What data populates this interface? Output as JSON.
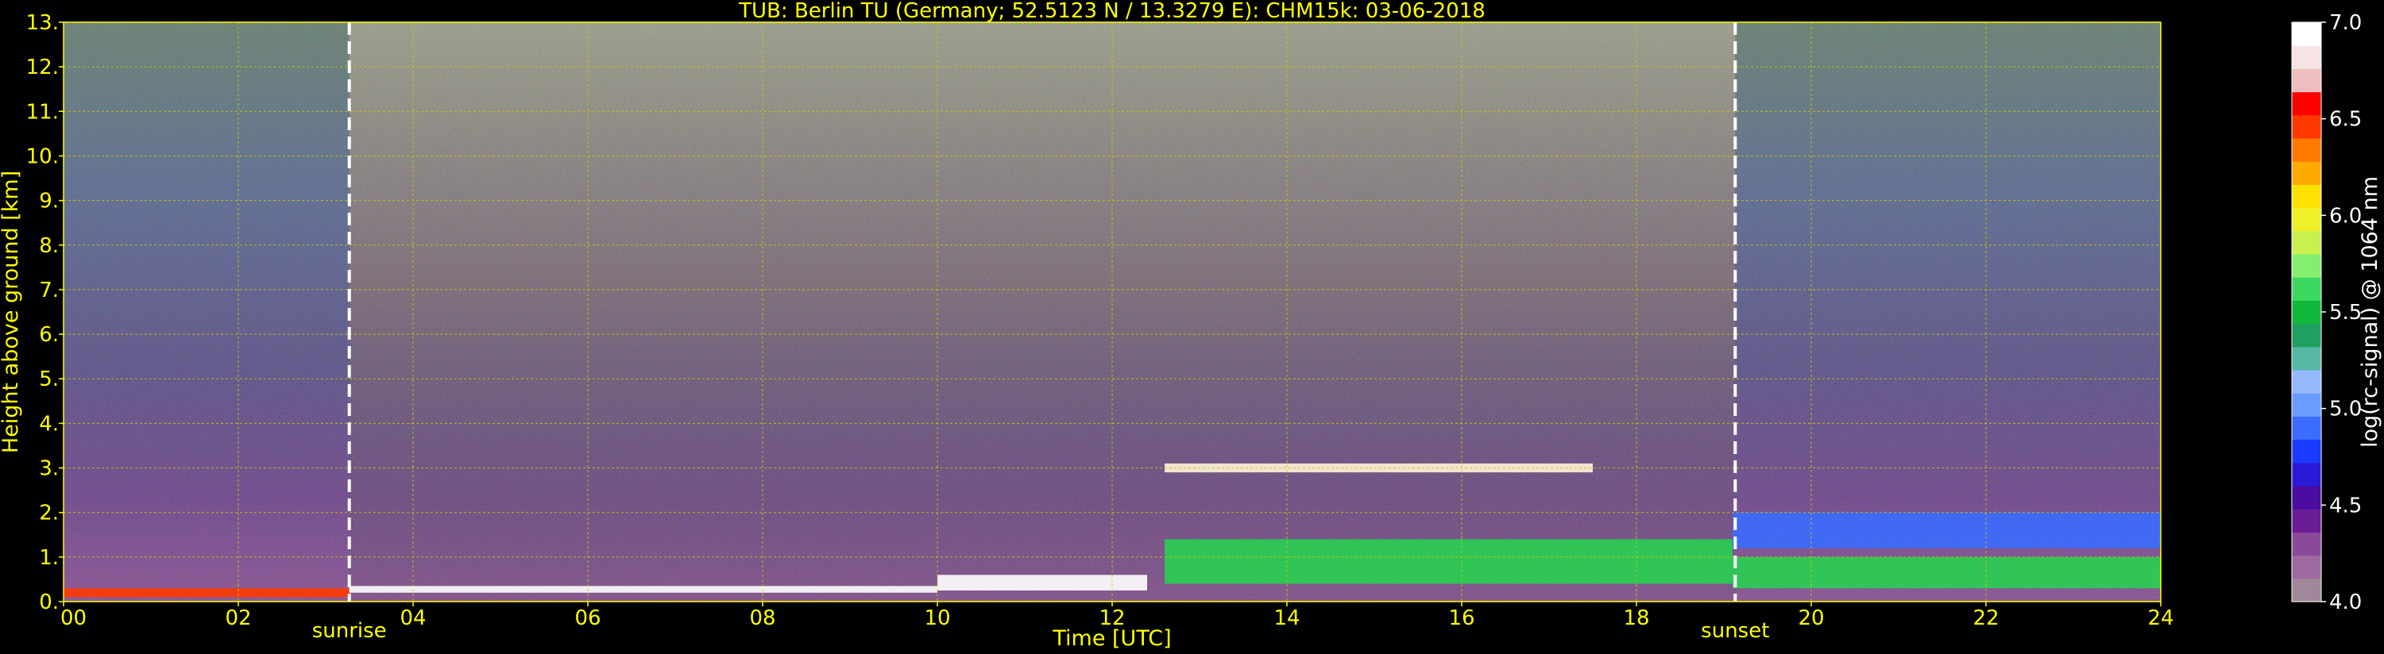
{
  "chart_data": {
    "type": "heatmap",
    "title": "TUB: Berlin TU (Germany; 52.5123 N / 13.3279 E):    CHM15k: 03-06-2018",
    "xlabel": "Time [UTC]",
    "ylabel": "Height above ground [km]",
    "xlim": [
      0,
      24
    ],
    "ylim": [
      0,
      13
    ],
    "x_ticks": [
      "00",
      "02",
      "04",
      "06",
      "08",
      "10",
      "12",
      "14",
      "16",
      "18",
      "20",
      "22",
      "24"
    ],
    "y_ticks": [
      "0.",
      "1.",
      "2.",
      "3.",
      "4.",
      "5.",
      "6.",
      "7.",
      "8.",
      "9.",
      "10.",
      "11.",
      "12.",
      "13."
    ],
    "grid": true,
    "colorbar": {
      "label": "log(rc-signal) @ 1064 nm",
      "range": [
        4.0,
        7.0
      ],
      "ticks": [
        "4.0",
        "4.5",
        "5.0",
        "5.5",
        "6.0",
        "6.5",
        "7.0"
      ],
      "colors": [
        "#a08898",
        "#9e6aa0",
        "#8a4a9a",
        "#6a1c96",
        "#4c0ca0",
        "#2a1ad8",
        "#1a3aff",
        "#3a6cff",
        "#6a9cff",
        "#96b8ff",
        "#58b8a8",
        "#20a060",
        "#12b83c",
        "#3cd860",
        "#86ee6e",
        "#c8f050",
        "#eef028",
        "#ffe000",
        "#ffaa00",
        "#ff7a00",
        "#ff3a00",
        "#ff0000",
        "#eebebe",
        "#f6e4e4",
        "#ffffff"
      ]
    },
    "markers": [
      {
        "label": "sunrise",
        "time": 3.27
      },
      {
        "label": "sunset",
        "time": 19.13
      }
    ],
    "layers": [
      {
        "t0": 0.0,
        "t1": 3.27,
        "h_bottom": 0.1,
        "h_top": 0.3,
        "color": "#ff3a00"
      },
      {
        "t0": 3.27,
        "t1": 10.0,
        "h_bottom": 0.2,
        "h_top": 0.35,
        "color": "#ffffff"
      },
      {
        "t0": 10.0,
        "t1": 12.4,
        "h_bottom": 0.25,
        "h_top": 0.6,
        "color": "#ffffff"
      },
      {
        "t0": 12.6,
        "t1": 17.5,
        "h_bottom": 2.9,
        "h_top": 3.1,
        "color": "#fff4d8"
      },
      {
        "t0": 12.6,
        "t1": 19.1,
        "h_bottom": 0.4,
        "h_top": 1.4,
        "color": "#28d050"
      },
      {
        "t0": 19.1,
        "t1": 24.0,
        "h_bottom": 1.2,
        "h_top": 2.0,
        "color": "#3a6cff"
      },
      {
        "t0": 19.1,
        "t1": 24.0,
        "h_bottom": 0.3,
        "h_top": 1.0,
        "color": "#28d050"
      }
    ]
  }
}
